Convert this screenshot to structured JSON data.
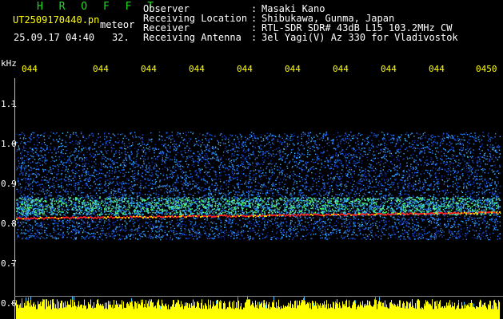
{
  "header": {
    "title": "H R O F F T",
    "filename": "UT2509170440.pn",
    "mode": "meteor",
    "datetime": "25.09.17 04:40",
    "count": "32.",
    "fields": [
      {
        "label": "Observer",
        "value": "Masaki Kano"
      },
      {
        "label": "Receiving Location",
        "value": "Shibukawa, Gunma, Japan"
      },
      {
        "label": "Receiver",
        "value": "RTL-SDR SDR# 43dB L15 103.2MHz CW"
      },
      {
        "label": "Receiving Antenna",
        "value": "3el Yagi(V) Az 330 for Vladivostok"
      }
    ],
    "colon": ":"
  },
  "y_axis": {
    "unit": "kHz",
    "ticks": [
      "1.1",
      "1.0",
      "0.9",
      "0.8",
      "0.7",
      "0.6"
    ]
  },
  "x_axis": {
    "ticks": [
      "044",
      "044",
      "044",
      "044",
      "044",
      "044",
      "044",
      "044",
      "044",
      "0450"
    ]
  },
  "colors": {
    "background": "#000000",
    "noise": "#1030c0",
    "signal": "#ff2020",
    "level": "#ffff00",
    "tick_text": "#ffff00"
  }
}
